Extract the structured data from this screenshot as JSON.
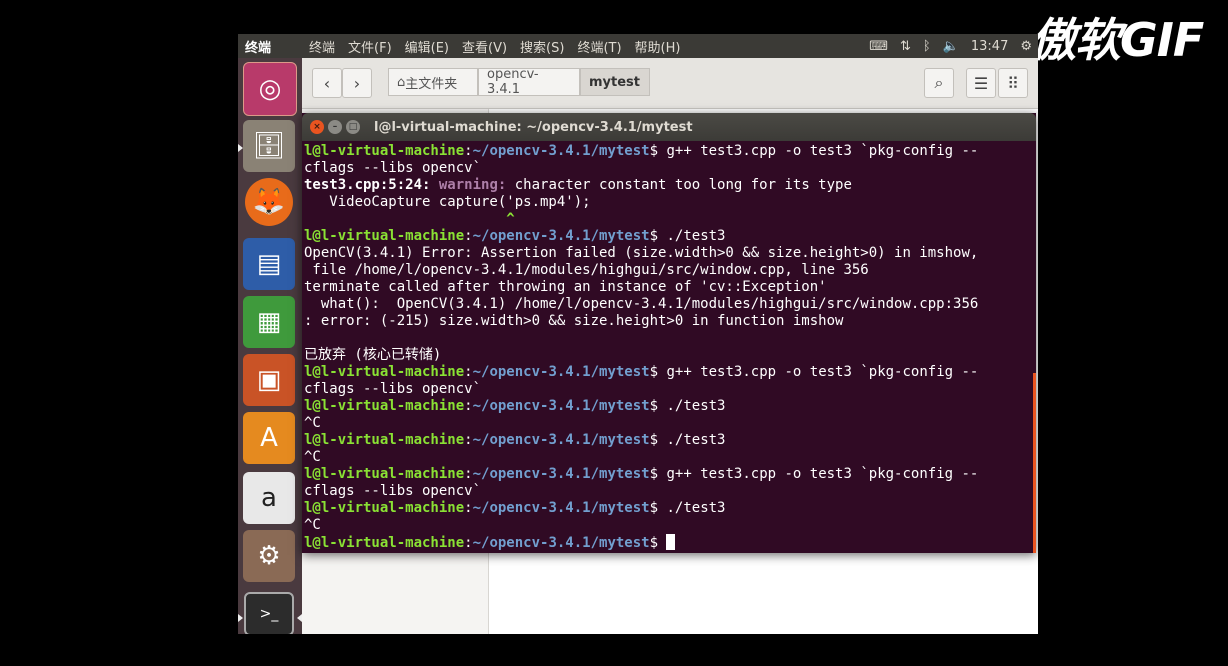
{
  "watermark": "傲软GIF",
  "panel": {
    "app_title": "终端",
    "menu": [
      "终端",
      "文件(F)",
      "编辑(E)",
      "查看(V)",
      "搜索(S)",
      "终端(T)",
      "帮助(H)"
    ],
    "time": "13:47",
    "indicators": [
      "keyboard-icon",
      "network-icon",
      "bluetooth-icon",
      "volume-icon",
      "gear-icon"
    ]
  },
  "launcher": {
    "items": [
      "ubuntu-dash-icon",
      "files-icon",
      "firefox-icon",
      "writer-icon",
      "calc-icon",
      "impress-icon",
      "software-center-icon",
      "amazon-icon",
      "system-settings-icon",
      "terminal-icon",
      "dvd-icon"
    ]
  },
  "file_manager": {
    "back": "‹",
    "forward": "›",
    "crumbs": [
      "主文件夹",
      "opencv-3.4.1",
      "mytest"
    ]
  },
  "terminal": {
    "title": "l@l-virtual-machine: ~/opencv-3.4.1/mytest",
    "prompt_user": "l@l-virtual-machine",
    "prompt_path": "~/opencv-3.4.1/mytest",
    "lines": {
      "cmd1a": " g++ test3.cpp -o test3 `pkg-config --",
      "cmd1b": "cflags --libs opencv`",
      "warn_file": "test3.cpp:5:24:",
      "warn_label": "warning:",
      "warn_msg": " character constant too long for its type",
      "code": "   VideoCapture capture('ps.mp4');",
      "caret": "                        ^",
      "cmd2": " ./test3",
      "err1": "OpenCV(3.4.1) Error: Assertion failed (size.width>0 && size.height>0) in imshow,",
      "err2": " file /home/l/opencv-3.4.1/modules/highgui/src/window.cpp, line 356",
      "err3": "terminate called after throwing an instance of 'cv::Exception'",
      "err4": "  what():  OpenCV(3.4.1) /home/l/opencv-3.4.1/modules/highgui/src/window.cpp:356",
      "err5": ": error: (-215) size.width>0 && size.height>0 in function imshow",
      "abort": "已放弃 (核心已转储)",
      "cmd3a": " g++ test3.cpp -o test3 `pkg-config --",
      "cmd3b": "cflags --libs opencv`",
      "cmd4": " ./test3",
      "ctrlc1": "^C",
      "cmd5": " ./test3",
      "ctrlc2": "^C",
      "cmd6a": " g++ test3.cpp -o test3 `pkg-config --",
      "cmd6b": "cflags --libs opencv`",
      "cmd7": " ./test3",
      "ctrlc3": "^C"
    }
  }
}
